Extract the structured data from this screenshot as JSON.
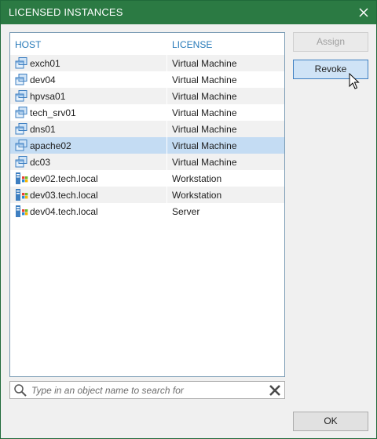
{
  "dialog": {
    "title": "LICENSED INSTANCES",
    "colors": {
      "titlebar": "#2b7a43",
      "header_text": "#2679b8",
      "selection": "#c4dcf3"
    }
  },
  "table": {
    "columns": {
      "host": "HOST",
      "license": "LICENSE"
    },
    "rows": [
      {
        "host": "exch01",
        "license": "Virtual Machine",
        "icon": "vm-icon",
        "selected": false
      },
      {
        "host": "dev04",
        "license": "Virtual Machine",
        "icon": "vm-icon",
        "selected": false
      },
      {
        "host": "hpvsa01",
        "license": "Virtual Machine",
        "icon": "vm-icon",
        "selected": false
      },
      {
        "host": "tech_srv01",
        "license": "Virtual Machine",
        "icon": "vm-icon",
        "selected": false
      },
      {
        "host": "dns01",
        "license": "Virtual Machine",
        "icon": "vm-icon",
        "selected": false
      },
      {
        "host": "apache02",
        "license": "Virtual Machine",
        "icon": "vm-icon",
        "selected": true
      },
      {
        "host": "dc03",
        "license": "Virtual Machine",
        "icon": "vm-icon",
        "selected": false
      },
      {
        "host": "dev02.tech.local",
        "license": "Workstation",
        "icon": "windows-computer-icon",
        "selected": false
      },
      {
        "host": "dev03.tech.local",
        "license": "Workstation",
        "icon": "windows-computer-icon",
        "selected": false
      },
      {
        "host": "dev04.tech.local",
        "license": "Server",
        "icon": "windows-computer-icon",
        "selected": false
      }
    ]
  },
  "buttons": {
    "assign": "Assign",
    "revoke": "Revoke",
    "ok": "OK"
  },
  "search": {
    "value": "",
    "placeholder": "Type in an object name to search for"
  }
}
